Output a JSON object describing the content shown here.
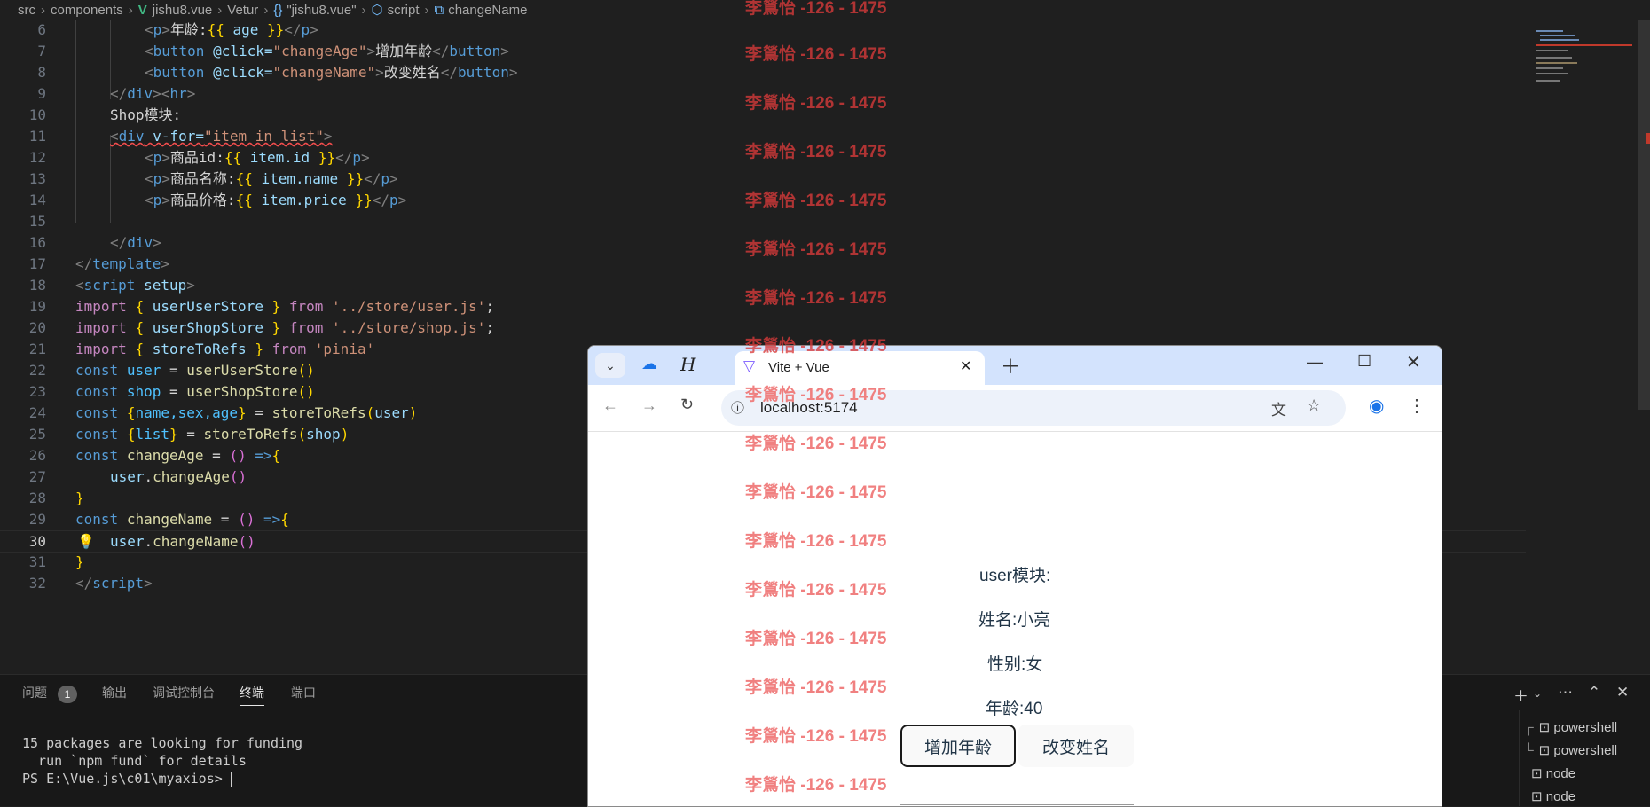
{
  "breadcrumb": {
    "p1": "src",
    "p2": "components",
    "file": "jishu8.vue",
    "p3": "Vetur",
    "p4": "\"jishu8.vue\"",
    "p5": "script",
    "p6": "changeName"
  },
  "code": {
    "n6": "6",
    "n7": "7",
    "n8": "8",
    "n9": "9",
    "n10": "10",
    "n11": "11",
    "n12": "12",
    "n13": "13",
    "n14": "14",
    "n15": "15",
    "n16": "16",
    "n17": "17",
    "n18": "18",
    "n19": "19",
    "n20": "20",
    "n21": "21",
    "n22": "22",
    "n23": "23",
    "n24": "24",
    "n25": "25",
    "n26": "26",
    "n27": "27",
    "n28": "28",
    "n29": "29",
    "n30": "30",
    "n31": "31",
    "n32": "32",
    "l6_text": "年龄:",
    "l7_attr": "@click=",
    "l7_val": "\"changeAge\"",
    "l7_text": "增加年龄",
    "l8_attr": "@click=",
    "l8_val": "\"changeName\"",
    "l8_text": "改变姓名",
    "l10_text": "Shop模块:",
    "l11_attr": "v-for=",
    "l11_val": "\"item in list\"",
    "l12_text": "商品id:",
    "l12_expr": "item.id",
    "l13_text": "商品名称:",
    "l13_expr": "item.name",
    "l14_text": "商品价格:",
    "l14_expr": "item.price",
    "l19_name": "userUserStore",
    "l19_path": "'../store/user.js'",
    "l20_name": "userShopStore",
    "l20_path": "'../store/shop.js'",
    "l21_name": "storeToRefs",
    "l21_path": "'pinia'",
    "l22_var": "user",
    "l22_fn": "userUserStore",
    "l23_var": "shop",
    "l23_fn": "userShopStore",
    "l24_vars": "name,sex,age",
    "l24_fn": "storeToRefs",
    "l24_arg": "user",
    "l25_vars": "list",
    "l25_fn": "storeToRefs",
    "l25_arg": "shop",
    "l26_fn": "changeAge",
    "l27_obj": "user",
    "l27_fn": "changeAge",
    "l29_fn": "changeName",
    "l30_obj": "user",
    "l30_fn": "changeName"
  },
  "panel": {
    "tab_problems": "问题",
    "badge": "1",
    "tab_output": "输出",
    "tab_debug": "调试控制台",
    "tab_terminal": "终端",
    "tab_ports": "端口",
    "term1": "15 packages are looking for funding",
    "term2": "  run `npm fund` for details",
    "term3": "PS E:\\Vue.js\\c01\\myaxios> ",
    "terminals": [
      "powershell",
      "powershell",
      "node",
      "node"
    ]
  },
  "browser": {
    "tab_title": "Vite + Vue",
    "url": "localhost:5174",
    "module_title": "user模块:",
    "name_line": "姓名:小亮",
    "sex_line": "性别:女",
    "age_line": "年龄:40",
    "btn_age": "增加年龄",
    "btn_name": "改变姓名"
  },
  "watermark": "李鶑怡 -126 - 1475",
  "colors": {
    "accent_red": "#d93a3a",
    "editor_bg": "#1f1f1f",
    "browser_tabstrip": "#d3e3fd"
  }
}
